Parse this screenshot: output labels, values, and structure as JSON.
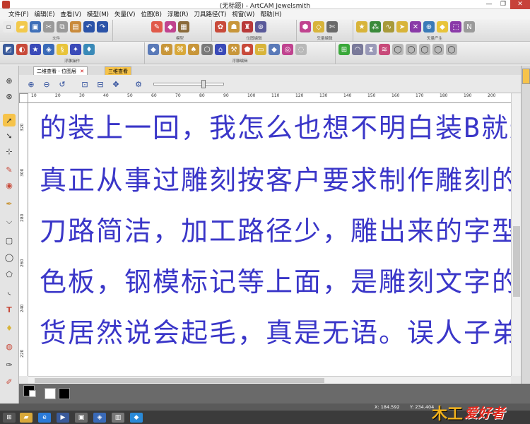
{
  "window": {
    "title": "(无标题) - ArtCAM Jewelsmith"
  },
  "menu": [
    "文件(F)",
    "编辑(E)",
    "查看(V)",
    "模型(M)",
    "矢量(V)",
    "位图(B)",
    "浮雕(R)",
    "刀具路径(T)",
    "视窗(W)",
    "帮助(H)"
  ],
  "toolbar_groups": {
    "file": "文件",
    "model": "模型",
    "bitmap": "位图编辑",
    "vector": "矢量产生",
    "relief": "浮雕操作",
    "relief_tools": "浮雕编辑",
    "vector_edit": "矢量编辑"
  },
  "tabs": {
    "active": "二维查看 - 位图层",
    "other": "三维查看"
  },
  "ruler_h": [
    "10",
    "20",
    "30",
    "40",
    "50",
    "60",
    "70",
    "80",
    "90",
    "100",
    "110",
    "120",
    "130",
    "140",
    "150",
    "160",
    "170",
    "180",
    "190",
    "200",
    "210"
  ],
  "ruler_v": [
    "320",
    "300",
    "280",
    "260",
    "240",
    "220"
  ],
  "canvas_lines": [
    "的装上一回，我怎么也想不明白装B就这",
    "真正从事过雕刻按客户要求制作雕刻的",
    "刀路简洁，加工路径少，雕出来的字型么",
    "色板，钢模标记等上面，是雕刻文字的一",
    "货居然说会起毛，真是无语。误人子弟"
  ],
  "status": {
    "x": "X: 184.592",
    "y": "Y: 234.404"
  },
  "logo": {
    "part1": "木工",
    "part2": "爱好者"
  },
  "colors": {
    "text": "#3a36c8",
    "active_tab": "#f6c34a",
    "close": "#c7423a"
  }
}
